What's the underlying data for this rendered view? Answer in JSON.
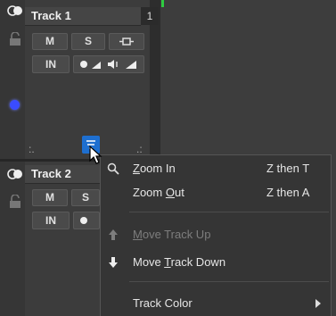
{
  "tracks": [
    {
      "name": "Track 1",
      "number": "1",
      "mute": "M",
      "solo": "S",
      "input": "IN"
    },
    {
      "name": "Track 2",
      "mute": "M",
      "solo": "S",
      "input": "IN"
    }
  ],
  "context_menu": {
    "zoom_in": {
      "pre": "",
      "key": "Z",
      "post": "oom In",
      "shortcut": "Z then T"
    },
    "zoom_out": {
      "pre": "Zoom ",
      "key": "O",
      "post": "ut",
      "shortcut": "Z then A"
    },
    "move_up": {
      "pre": "",
      "key": "M",
      "post": "ove Track Up"
    },
    "move_down": {
      "pre": "Move ",
      "key": "T",
      "post": "rack Down"
    },
    "track_color": {
      "label": "Track Color"
    }
  },
  "colors": {
    "accent": "#1e6fd0",
    "record_dot": "#3a4cff",
    "green_marker": "#2ecc40"
  }
}
